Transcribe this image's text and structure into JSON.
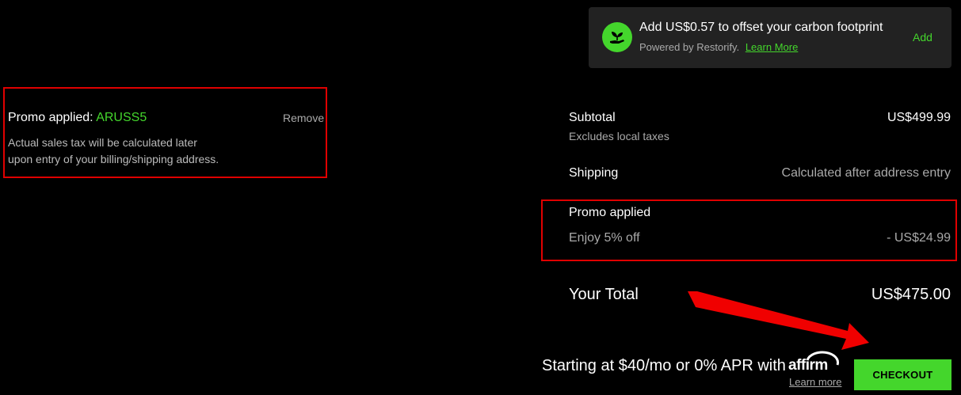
{
  "carbon_offset": {
    "title": "Add US$0.57 to offset your carbon footprint",
    "powered_by": "Powered by Restorify.",
    "learn_more": "Learn More",
    "add_label": "Add",
    "icon": "plant-hand-icon"
  },
  "promo_left": {
    "title": "Promo applied:",
    "code": "ARUSS5",
    "remove_label": "Remove",
    "note_line1": "Actual sales tax will be calculated later",
    "note_line2": "upon entry of your billing/shipping address."
  },
  "summary": {
    "subtotal_label": "Subtotal",
    "subtotal_value": "US$499.99",
    "subtotal_note": "Excludes local taxes",
    "shipping_label": "Shipping",
    "shipping_value": "Calculated after address entry",
    "promo_title": "Promo applied",
    "promo_desc": "Enjoy 5% off",
    "promo_value": "- US$24.99",
    "total_label": "Your Total",
    "total_value": "US$475.00"
  },
  "financing": {
    "text": "Starting at $40/mo or 0% APR with",
    "logo": "affirm",
    "learn_more": "Learn more"
  },
  "checkout": {
    "label": "CHECKOUT"
  },
  "colors": {
    "accent": "#44d62c",
    "highlight": "#e00000",
    "background": "#000000",
    "card": "#222222"
  }
}
